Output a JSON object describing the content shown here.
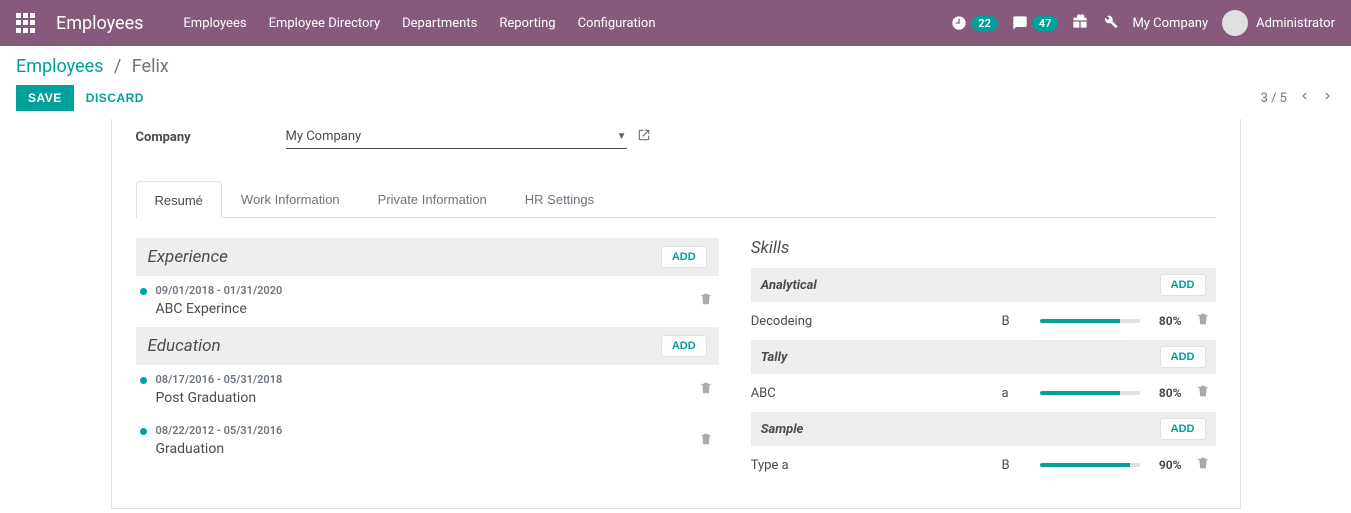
{
  "nav": {
    "app_title": "Employees",
    "menu": [
      "Employees",
      "Employee Directory",
      "Departments",
      "Reporting",
      "Configuration"
    ],
    "badge1": "22",
    "badge2": "47",
    "company": "My Company",
    "user": "Administrator"
  },
  "breadcrumb": {
    "root": "Employees",
    "current": "Felix"
  },
  "actions": {
    "save": "SAVE",
    "discard": "DISCARD"
  },
  "pager": {
    "text": "3 / 5"
  },
  "form": {
    "company_label": "Company",
    "company_value": "My Company"
  },
  "tabs": [
    "Resumé",
    "Work Information",
    "Private Information",
    "HR Settings"
  ],
  "add_label": "ADD",
  "resume": {
    "sections": [
      {
        "title": "Experience",
        "items": [
          {
            "dates": "09/01/2018 - 01/31/2020",
            "title": "ABC Experince"
          }
        ]
      },
      {
        "title": "Education",
        "items": [
          {
            "dates": "08/17/2016 - 05/31/2018",
            "title": "Post Graduation"
          },
          {
            "dates": "08/22/2012 - 05/31/2016",
            "title": "Graduation"
          }
        ]
      }
    ]
  },
  "skills": {
    "title": "Skills",
    "groups": [
      {
        "name": "Analytical",
        "items": [
          {
            "name": "Decodeing",
            "level": "B",
            "pct": 80
          }
        ]
      },
      {
        "name": "Tally",
        "items": [
          {
            "name": "ABC",
            "level": "a",
            "pct": 80
          }
        ]
      },
      {
        "name": "Sample",
        "items": [
          {
            "name": "Type a",
            "level": "B",
            "pct": 90
          }
        ]
      }
    ]
  }
}
